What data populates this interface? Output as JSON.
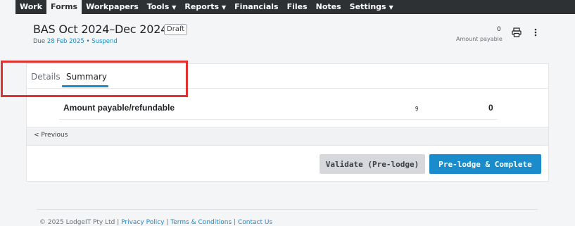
{
  "nav": {
    "items": [
      {
        "label": "Work",
        "caret": false,
        "active": false
      },
      {
        "label": "Forms",
        "caret": false,
        "active": true
      },
      {
        "label": "Workpapers",
        "caret": false,
        "active": false
      },
      {
        "label": "Tools",
        "caret": true,
        "active": false
      },
      {
        "label": "Reports",
        "caret": true,
        "active": false
      },
      {
        "label": "Financials",
        "caret": false,
        "active": false
      },
      {
        "label": "Files",
        "caret": false,
        "active": false
      },
      {
        "label": "Notes",
        "caret": false,
        "active": false
      },
      {
        "label": "Settings",
        "caret": true,
        "active": false
      }
    ],
    "caret_glyph": "▼"
  },
  "header": {
    "title": "BAS Oct 2024–Dec 2024",
    "badge": "Draft",
    "due_prefix": "Due",
    "due_date": "28 Feb 2025",
    "separator": "•",
    "suspend_link": "Suspend",
    "amount_value": "0",
    "amount_label": "Amount payable"
  },
  "tabs": {
    "details": "Details",
    "summary": "Summary"
  },
  "summary_row": {
    "label": "Amount payable/refundable",
    "code": "9",
    "value": "0"
  },
  "pagination": {
    "previous": "< Previous"
  },
  "actions": {
    "validate": "Validate (Pre-lodge)",
    "prelodge": "Pre-lodge & Complete"
  },
  "footer": {
    "copyright": "© 2025 LodgeIT Pty Ltd |",
    "privacy": "Privacy Policy",
    "sep1": "|",
    "terms": "Terms & Conditions",
    "sep2": "|",
    "contact": "Contact Us"
  },
  "colors": {
    "nav_bg": "#2e3134",
    "accent": "#1a8ccc",
    "annotation": "#e03030",
    "disabled_button": "#d6d8dc"
  },
  "icons": {
    "print": "printer-icon",
    "more": "more-vertical-icon"
  }
}
